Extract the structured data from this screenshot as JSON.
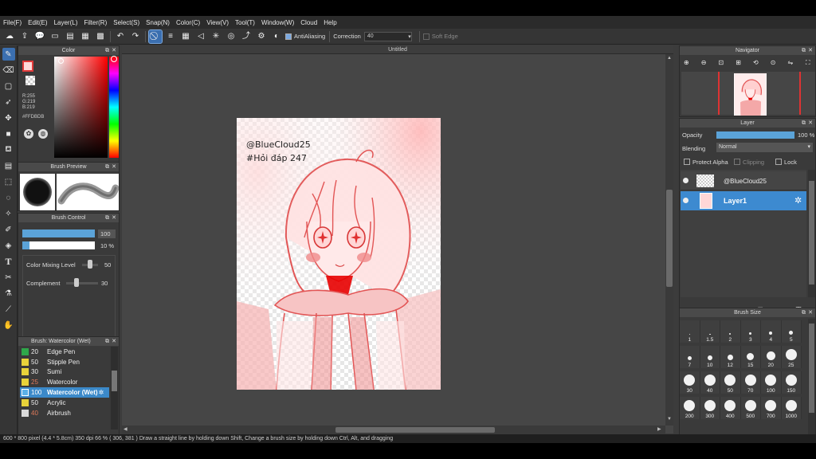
{
  "menu": [
    "File(F)",
    "Edit(E)",
    "Layer(L)",
    "Filter(R)",
    "Select(S)",
    "Snap(N)",
    "Color(C)",
    "View(V)",
    "Tool(T)",
    "Window(W)",
    "Cloud",
    "Help"
  ],
  "toolbar": {
    "antialiasing_label": "AntiAliasing",
    "correction_label": "Correction",
    "correction_value": "40",
    "soft_edge_label": "Soft Edge"
  },
  "color_panel": {
    "title": "Color",
    "r": "R:255",
    "g": "G:219",
    "b": "B:219",
    "hex": "#FFDBDB",
    "colors": {
      "main": "#ffdbdb",
      "accent": "#e03a3a"
    }
  },
  "brush_preview": {
    "title": "Brush Preview"
  },
  "brush_control": {
    "title": "Brush Control",
    "size_value": "100",
    "opacity_value": "10 %",
    "mixing_label": "Color Mixing Level",
    "mixing_value": "50",
    "complement_label": "Complement",
    "complement_value": "30"
  },
  "brush_list": {
    "title": "Brush: Watercolor (Wet)",
    "items": [
      {
        "size": "20",
        "name": "Edge Pen",
        "color": "#2fa84a"
      },
      {
        "size": "50",
        "name": "Stipple Pen",
        "color": "#e8d23a"
      },
      {
        "size": "30",
        "name": "Sumi",
        "color": "#e8d23a"
      },
      {
        "size": "25",
        "name": "Watercolor",
        "color": "#e8d23a"
      },
      {
        "size": "100",
        "name": "Watercolor (Wet)",
        "color": "#5ab0e8"
      },
      {
        "size": "50",
        "name": "Acrylic",
        "color": "#e8d23a"
      },
      {
        "size": "40",
        "name": "Airbrush",
        "color": "#d9d9d9"
      }
    ]
  },
  "canvas": {
    "tab_title": "Untitled",
    "watermark_1": "@BlueCloud25",
    "watermark_2": "#Hỏi đáp 247"
  },
  "navigator": {
    "title": "Navigator"
  },
  "layer_panel": {
    "title": "Layer",
    "opacity_label": "Opacity",
    "opacity_value": "100 %",
    "blending_label": "Blending",
    "blending_value": "Normal",
    "protect_alpha": "Protect Alpha",
    "clipping": "Clipping",
    "lock": "Lock",
    "layers": [
      "@BlueCloud25",
      "Layer1"
    ]
  },
  "brush_size": {
    "title": "Brush Size",
    "sizes": [
      "1",
      "1.5",
      "2",
      "3",
      "4",
      "5",
      "7",
      "10",
      "12",
      "15",
      "20",
      "25",
      "30",
      "40",
      "50",
      "70",
      "100",
      "150",
      "200",
      "300",
      "400",
      "500",
      "700",
      "1000"
    ]
  },
  "status": {
    "text": "600 * 800 pixel    (4.4 * 5.8cm)   350 dpi    66 %    ( 306, 381 )    Draw a straight line by holding down Shift, Change a brush size by holding down Ctrl, Alt, and dragging"
  }
}
